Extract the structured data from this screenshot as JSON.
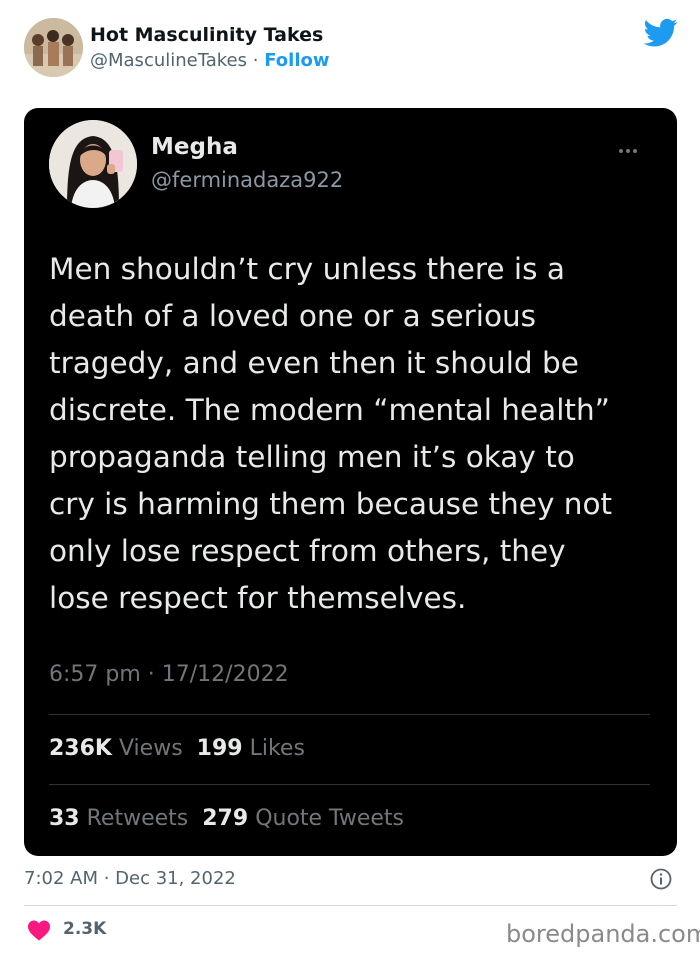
{
  "outer": {
    "author_name": "Hot Masculinity Takes",
    "handle": "@MasculineTakes",
    "separator": "·",
    "follow_label": "Follow",
    "timestamp": "7:02 AM · Dec 31, 2022",
    "like_count": "2.3K"
  },
  "embedded_tweet": {
    "author_name": "Megha",
    "handle": "@ferminadaza922",
    "text_lines": [
      "Men shouldn’t cry unless there is a",
      "death of a loved one or a serious",
      "tragedy, and even then it should be",
      "discrete. The modern “mental health”",
      "propaganda telling men it’s okay to",
      "cry is harming them because they not",
      "only lose respect from others, they",
      "lose respect for themselves."
    ],
    "timestamp": "6:57 pm · 17/12/2022",
    "views_count": "236K",
    "views_label": "Views",
    "likes_count": "199",
    "likes_label": "Likes",
    "retweets_count": "33",
    "retweets_label": "Retweets",
    "quotes_count": "279",
    "quotes_label": "Quote Tweets"
  },
  "watermark": "boredpanda.com",
  "colors": {
    "brand_blue": "#1d9bf0",
    "heart_red": "#f91880",
    "embed_background": "#000000"
  },
  "icons": [
    "twitter-bird-icon",
    "more-options-icon",
    "info-icon",
    "heart-icon"
  ]
}
